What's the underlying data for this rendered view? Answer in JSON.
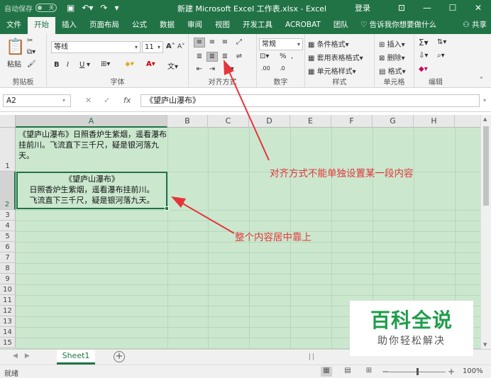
{
  "titlebar": {
    "autosave": "自动保存",
    "autosave_state": "关",
    "title": "新建 Microsoft Excel 工作表.xlsx  -  Excel",
    "login": "登录",
    "icons": [
      "save-icon",
      "undo-icon",
      "redo-icon",
      "customize-icon",
      "ribbon-display-icon",
      "minimize-icon",
      "maximize-icon",
      "close-icon"
    ]
  },
  "tabs": [
    "文件",
    "开始",
    "插入",
    "页面布局",
    "公式",
    "数据",
    "审阅",
    "视图",
    "开发工具",
    "ACROBAT",
    "团队"
  ],
  "active_tab": "开始",
  "tell_me": "告诉我你想要做什么",
  "share": "共享",
  "ribbon": {
    "clipboard": {
      "paste": "粘贴",
      "label": "剪贴板"
    },
    "font": {
      "name": "等线",
      "size": "11",
      "bold": "B",
      "italic": "I",
      "underline": "U",
      "grow": "A",
      "shrink": "A",
      "label": "字体"
    },
    "alignment": {
      "label": "对齐方式"
    },
    "number": {
      "format": "常规",
      "percent": "%",
      "comma": ",",
      "label": "数字"
    },
    "styles": {
      "conditional": "条件格式",
      "table": "套用表格格式",
      "cell": "单元格样式",
      "label": "样式"
    },
    "cells": {
      "insert": "插入",
      "delete": "删除",
      "format": "格式",
      "label": "单元格"
    },
    "editing": {
      "label": "编辑"
    }
  },
  "formula": {
    "namebox": "A2",
    "content": "《望庐山瀑布》",
    "cancel": "✕",
    "enter": "✓",
    "fx": "fx"
  },
  "columns": [
    "A",
    "B",
    "C",
    "D",
    "E",
    "F",
    "G",
    "H"
  ],
  "active_column": "A",
  "rows": [
    "1",
    "2",
    "3",
    "4",
    "5",
    "6",
    "7",
    "8",
    "9",
    "10",
    "11",
    "12",
    "13",
    "14",
    "15"
  ],
  "active_row": "2",
  "cells": {
    "A1": "《望庐山瀑布》日照香炉生紫烟，遥看瀑布挂前川。飞流直下三千尺，疑是银河落九天。",
    "A2_line1": "《望庐山瀑布》",
    "A2_line2": "日照香炉生紫烟，遥看瀑布挂前川。",
    "A2_line3": "飞流直下三千尺，疑是银河落九天。"
  },
  "annotations": {
    "top": "对齐方式不能单独设置某一段内容",
    "bottom": "整个内容居中靠上",
    "color": "#e5343a"
  },
  "sheets": [
    "Sheet1"
  ],
  "status": {
    "text": "就绪",
    "zoom": "100%"
  },
  "watermark": {
    "title": "百科全说",
    "subtitle": "助你轻松解决"
  },
  "accent_color": "#217346"
}
